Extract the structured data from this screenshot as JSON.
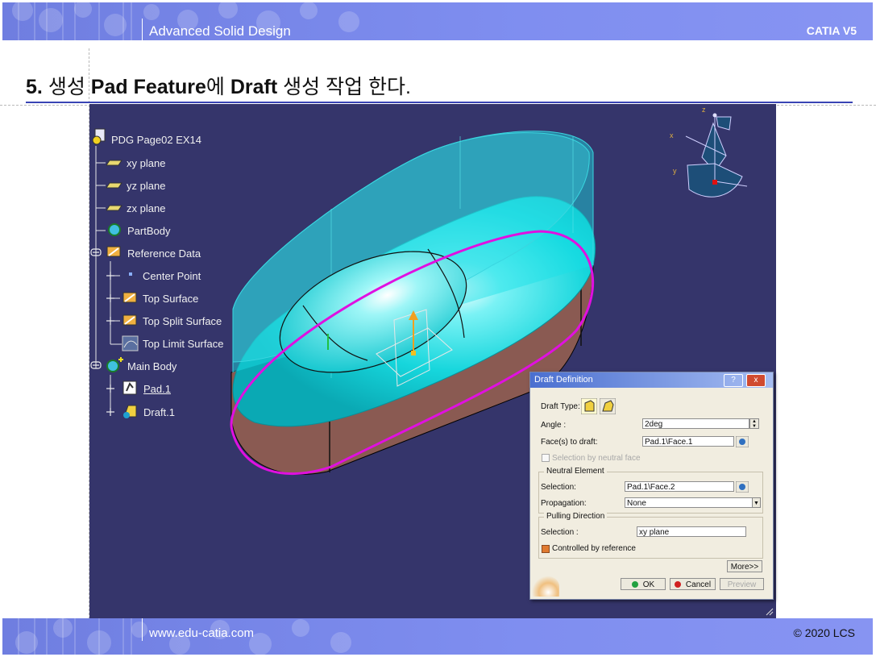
{
  "header": {
    "title": "Advanced Solid Design",
    "product": "CATIA V5"
  },
  "heading": {
    "number": "5.",
    "w1": "생성",
    "w2": "Pad Feature",
    "w3": "에",
    "w4": "Draft",
    "w5": "생성 작업 한다."
  },
  "footer": {
    "url": "www.edu-catia.com",
    "copyright": "© 2020 LCS"
  },
  "tree": {
    "items": [
      {
        "label": "PDG Page02 EX14",
        "icon": "part-document-icon"
      },
      {
        "label": "xy plane",
        "icon": "plane-icon"
      },
      {
        "label": "yz plane",
        "icon": "plane-icon"
      },
      {
        "label": "zx plane",
        "icon": "plane-icon"
      },
      {
        "label": "PartBody",
        "icon": "part-body-icon"
      },
      {
        "label": "Reference Data",
        "icon": "geometrical-set-icon"
      },
      {
        "label": "Center Point",
        "icon": "point-icon"
      },
      {
        "label": "Top Surface",
        "icon": "geometrical-set-icon"
      },
      {
        "label": "Top Split Surface",
        "icon": "geometrical-set-icon"
      },
      {
        "label": "Top Limit Surface",
        "icon": "surface-icon"
      },
      {
        "label": "Main Body",
        "icon": "body-icon"
      },
      {
        "label": "Pad.1",
        "icon": "pad-icon"
      },
      {
        "label": "Draft.1",
        "icon": "draft-icon"
      }
    ]
  },
  "compass": {
    "x": "x",
    "y": "y",
    "z": "z"
  },
  "dialog": {
    "title": "Draft Definition",
    "help": "?",
    "close": "x",
    "draft_type_label": "Draft Type:",
    "angle_label": "Angle :",
    "angle_value": "2deg",
    "faces_label": "Face(s) to draft:",
    "faces_value": "Pad.1\\Face.1",
    "selection_neutral": "Selection by neutral face",
    "neutral_group": "Neutral Element",
    "neutral_selection_label": "Selection:",
    "neutral_selection_value": "Pad.1\\Face.2",
    "propagation_label": "Propagation:",
    "propagation_value": "None",
    "pulling_group": "Pulling Direction",
    "pulling_selection_label": "Selection :",
    "pulling_selection_value": "xy plane",
    "controlled_label": "Controlled by reference",
    "more_label": "More>>",
    "ok_label": "OK",
    "cancel_label": "Cancel",
    "preview_label": "Preview"
  },
  "colors": {
    "header_blue": "#7f8ef0",
    "viewport_bg": "#35356b",
    "pad_top": "#19e1e6",
    "pad_side": "#8a5a52",
    "draft_outline": "#e010e0",
    "heading_rule": "#3944b4"
  }
}
